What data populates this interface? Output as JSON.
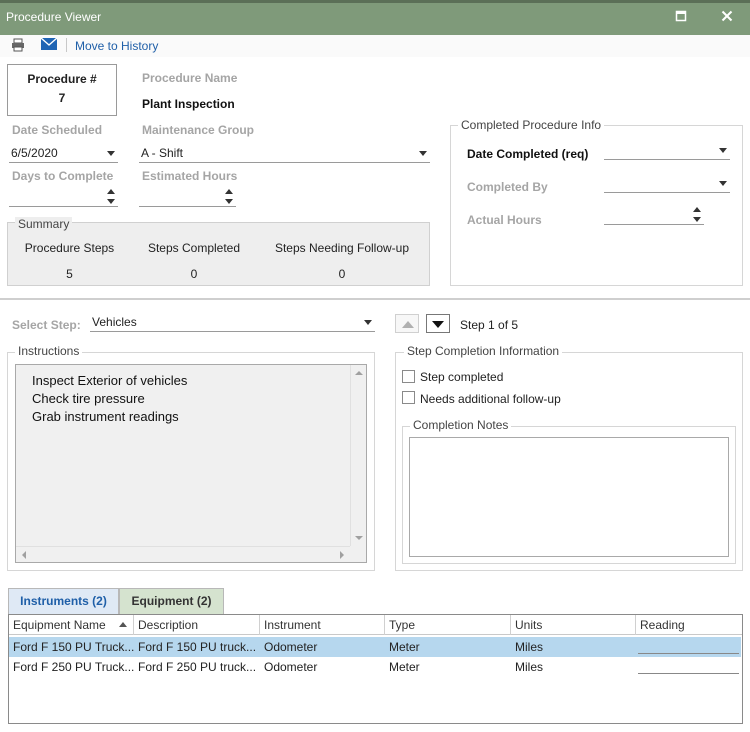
{
  "window": {
    "title": "Procedure Viewer",
    "maximize_icon": "maximize-icon",
    "close_icon": "close-icon"
  },
  "toolbar": {
    "print_icon": "printer-icon",
    "email_icon": "mail-icon",
    "move_to_history": "Move to History"
  },
  "procedure": {
    "number_label": "Procedure #",
    "number_value": "7",
    "name_label": "Procedure Name",
    "name_value": "Plant Inspection",
    "date_scheduled_label": "Date Scheduled",
    "date_scheduled_value": "6/5/2020",
    "maintenance_group_label": "Maintenance Group",
    "maintenance_group_value": "A - Shift",
    "days_to_complete_label": "Days to Complete",
    "days_to_complete_value": "",
    "estimated_hours_label": "Estimated Hours",
    "estimated_hours_value": ""
  },
  "summary": {
    "title": "Summary",
    "columns": [
      {
        "label": "Procedure Steps",
        "value": "5"
      },
      {
        "label": "Steps Completed",
        "value": "0"
      },
      {
        "label": "Steps Needing Follow-up",
        "value": "0"
      }
    ]
  },
  "completed_info": {
    "title": "Completed Procedure Info",
    "date_completed_label": "Date Completed (req)",
    "date_completed_value": "",
    "completed_by_label": "Completed By",
    "completed_by_value": "",
    "actual_hours_label": "Actual Hours",
    "actual_hours_value": ""
  },
  "step_nav": {
    "select_step_label": "Select Step:",
    "select_step_value": "Vehicles",
    "step_counter": "Step 1 of 5"
  },
  "instructions": {
    "title": "Instructions",
    "lines": [
      "Inspect Exterior of vehicles",
      "Check tire pressure",
      "Grab instrument readings"
    ]
  },
  "step_completion": {
    "title": "Step Completion Information",
    "step_completed": "Step completed",
    "needs_followup": "Needs additional follow-up",
    "notes_title": "Completion Notes",
    "notes_value": ""
  },
  "tabs": [
    {
      "label": "Instruments  (2)",
      "active": true
    },
    {
      "label": "Equipment  (2)",
      "active": false
    }
  ],
  "grid": {
    "columns": [
      "Equipment Name",
      "Description",
      "Instrument",
      "Type",
      "Units",
      "Reading"
    ],
    "rows": [
      [
        "Ford F 150 PU Truck...",
        "Ford F 150 PU truck...",
        "Odometer",
        "Meter",
        "Miles",
        ""
      ],
      [
        "Ford F 250 PU Truck...",
        "Ford F 250 PU truck...",
        "Odometer",
        "Meter",
        "Miles",
        ""
      ]
    ]
  },
  "colors": {
    "titlebar": "#7f9a7a",
    "selected_row": "#b6d7ee",
    "link": "#1f5fa8",
    "active_tab_text": "#1f5fa8",
    "inactive_tab_bg": "#d5e3cf"
  }
}
